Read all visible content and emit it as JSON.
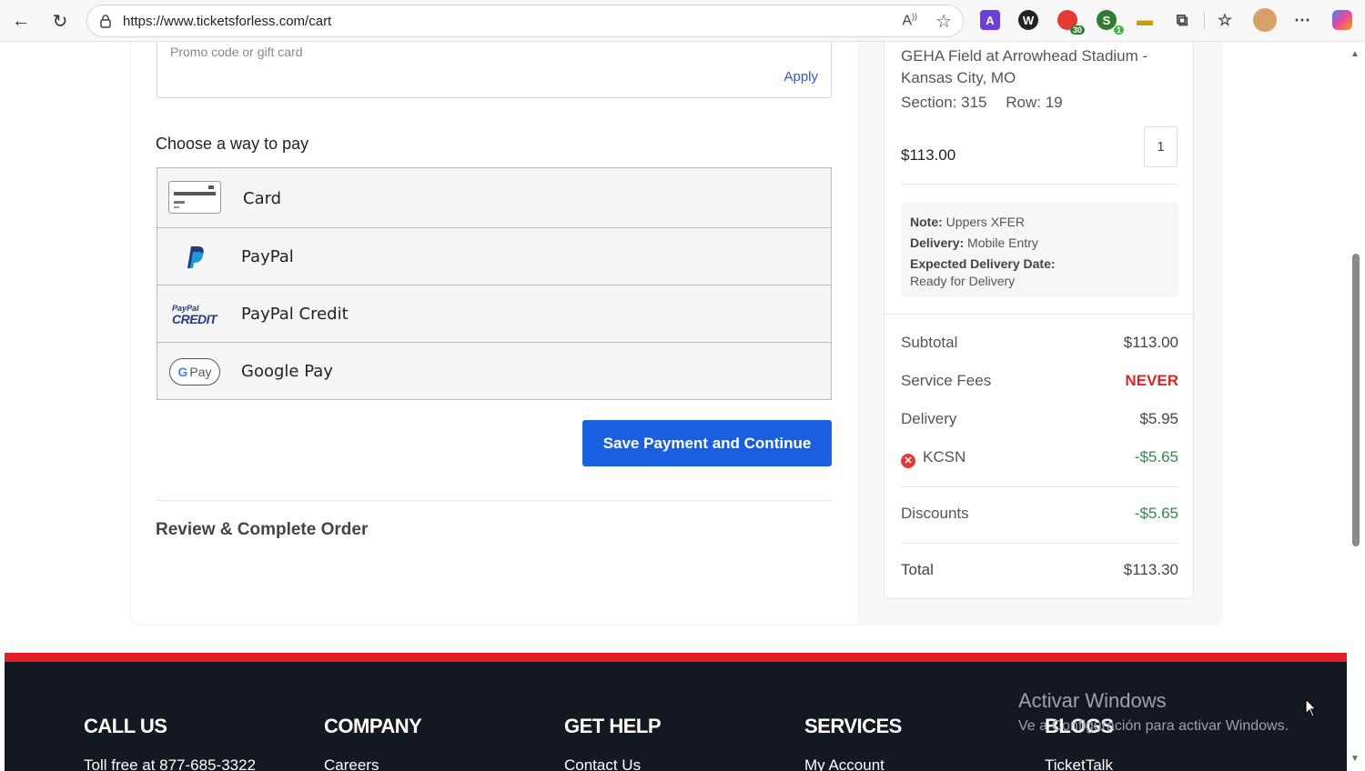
{
  "browser": {
    "url": "https://www.ticketsforless.com/cart",
    "extensions": [
      {
        "name": "A",
        "color": "#6d3fd9"
      },
      {
        "name": "W",
        "color": "#222222"
      },
      {
        "name": "",
        "color": "#e53935",
        "badge": "30",
        "badge_color": "#2e7d32"
      },
      {
        "name": "S",
        "color": "#2e7d32",
        "badge": "1",
        "badge_color": "#4caf50"
      }
    ]
  },
  "promo": {
    "placeholder": "Promo code or gift card",
    "apply_label": "Apply"
  },
  "payment": {
    "heading": "Choose a way to pay",
    "methods": [
      {
        "label": "Card",
        "icon": "card-icon"
      },
      {
        "label": "PayPal",
        "icon": "paypal-icon"
      },
      {
        "label": "PayPal Credit",
        "icon": "paypal-credit-icon",
        "icon_text_top": "PayPal",
        "icon_text_bottom": "CREDIT"
      },
      {
        "label": "Google Pay",
        "icon": "google-pay-icon",
        "icon_text": "Pay"
      }
    ],
    "save_button": "Save Payment and Continue"
  },
  "review": {
    "heading": "Review & Complete Order"
  },
  "summary": {
    "venue": "GEHA Field at Arrowhead Stadium - Kansas City, MO",
    "section": "Section: 315",
    "row": "Row: 19",
    "price": "$113.00",
    "quantity": "1",
    "note_label": "Note:",
    "note_value": "Uppers XFER",
    "delivery_label": "Delivery:",
    "delivery_value": "Mobile Entry",
    "expected_label": "Expected Delivery Date:",
    "expected_value": "Ready for Delivery",
    "lines": {
      "subtotal_label": "Subtotal",
      "subtotal_value": "$113.00",
      "fees_label": "Service Fees",
      "fees_value": "NEVER",
      "delivery_label": "Delivery",
      "delivery_value": "$5.95",
      "kcsn_label": "KCSN",
      "kcsn_value": "-$5.65",
      "discounts_label": "Discounts",
      "discounts_value": "-$5.65",
      "total_label": "Total",
      "total_value": "$113.30"
    }
  },
  "footer": {
    "columns": [
      {
        "heading": "CALL US",
        "link": "Toll free at 877-685-3322"
      },
      {
        "heading": "COMPANY",
        "link": "Careers"
      },
      {
        "heading": "GET HELP",
        "link": "Contact Us"
      },
      {
        "heading": "SERVICES",
        "link": "My Account"
      },
      {
        "heading": "BLOGS",
        "link": "TicketTalk"
      }
    ],
    "watermark_title": "Activar Windows",
    "watermark_sub": "Ve a Configuración para activar Windows."
  }
}
